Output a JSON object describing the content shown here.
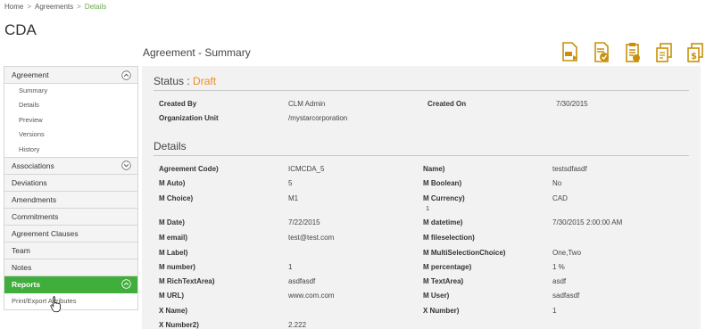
{
  "breadcrumb": {
    "home": "Home",
    "sep": ">",
    "agreements": "Agreements",
    "details": "Details"
  },
  "page": {
    "title": "CDA",
    "summary_title": "Agreement - Summary"
  },
  "toolbar": {
    "icons": [
      "document-export-icon",
      "document-approve-icon",
      "clipboard-icon",
      "copy-document-icon",
      "document-money-icon"
    ]
  },
  "sidebar": {
    "agreement": "Agreement",
    "sub_items": [
      "Summary",
      "Details",
      "Preview",
      "Versions",
      "History"
    ],
    "associations": "Associations",
    "sections": [
      "Deviations",
      "Amendments",
      "Commitments",
      "Agreement Clauses",
      "Team",
      "Notes"
    ],
    "reports": "Reports",
    "print_export": "Print/Export Attributes"
  },
  "status": {
    "label": "Status :",
    "value": "Draft"
  },
  "meta": {
    "created_by_label": "Created By",
    "created_by_value": "CLM Admin",
    "created_on_label": "Created On",
    "created_on_value": "7/30/2015",
    "org_unit_label": "Organization Unit",
    "org_unit_value": "/mystarcorporation"
  },
  "details": {
    "title": "Details",
    "rows": [
      {
        "l1": "Agreement Code)",
        "v1": "ICMCDA_5",
        "l2": "Name)",
        "v2": "testsdfasdf"
      },
      {
        "l1": "M Auto)",
        "v1": "5",
        "l2": "M Boolean)",
        "v2": "No"
      },
      {
        "l1": "M Choice)",
        "v1": "M1",
        "l2": "M Currency)",
        "v2": "CAD",
        "v2b": "1"
      },
      {
        "l1": "M Date)",
        "v1": "7/22/2015",
        "l2": "M datetime)",
        "v2": "7/30/2015 2:00:00 AM"
      },
      {
        "l1": "M email)",
        "v1": "test@test.com",
        "l2": "M fileselection)",
        "v2": ""
      },
      {
        "l1": "M Label)",
        "v1": "",
        "l2": "M MultiSelectionChoice)",
        "v2": "One,Two"
      },
      {
        "l1": "M number)",
        "v1": "1",
        "l2": "M percentage)",
        "v2": "1 %"
      },
      {
        "l1": "M RichTextArea)",
        "v1": "asdfasdf",
        "l2": "M TextArea)",
        "v2": "asdf"
      },
      {
        "l1": "M URL)",
        "v1": "www.com.com",
        "l2": "M User)",
        "v2": "sadfasdf"
      },
      {
        "l1": "X Name)",
        "v1": "",
        "l2": "X Number)",
        "v2": "1"
      },
      {
        "l1": "X Number2)",
        "v1": "2.222",
        "l2": "",
        "v2": ""
      }
    ]
  },
  "colors": {
    "accent_green": "#3fae3b",
    "draft_orange": "#f08c1e",
    "icon_gold": "#c8900a"
  }
}
